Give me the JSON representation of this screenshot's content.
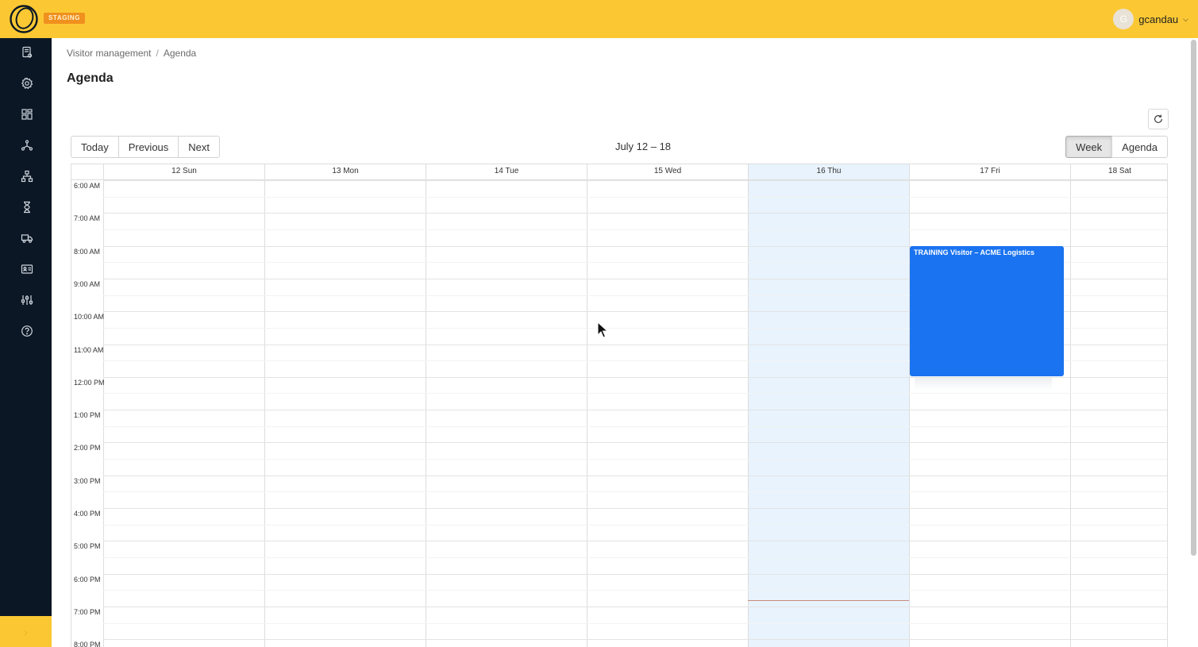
{
  "header": {
    "env_badge": "STAGING",
    "user": {
      "initial": "G",
      "name": "gcandau"
    }
  },
  "sidebar": {
    "items": [
      {
        "name": "report-icon"
      },
      {
        "name": "gear-icon"
      },
      {
        "name": "dashboard-icon"
      },
      {
        "name": "network-icon"
      },
      {
        "name": "org-chart-icon"
      },
      {
        "name": "hourglass-icon"
      },
      {
        "name": "truck-icon"
      },
      {
        "name": "id-card-icon"
      },
      {
        "name": "sliders-icon"
      },
      {
        "name": "help-icon"
      }
    ],
    "expand_label": "›"
  },
  "breadcrumb": {
    "parent": "Visitor management",
    "separator": "/",
    "current": "Agenda"
  },
  "page_title": "Agenda",
  "toolbar": {
    "today": "Today",
    "previous": "Previous",
    "next": "Next",
    "range": "July 12 – 18",
    "week": "Week",
    "agenda": "Agenda",
    "active_view": "week"
  },
  "calendar": {
    "days": [
      "12 Sun",
      "13 Mon",
      "14 Tue",
      "15 Wed",
      "16 Thu",
      "17 Fri",
      "18 Sat"
    ],
    "today_index": 4,
    "hours": [
      "6:00 AM",
      "7:00 AM",
      "8:00 AM",
      "9:00 AM",
      "10:00 AM",
      "11:00 AM",
      "12:00 PM",
      "1:00 PM",
      "2:00 PM",
      "3:00 PM",
      "4:00 PM",
      "5:00 PM",
      "6:00 PM",
      "7:00 PM",
      "8:00 PM"
    ],
    "events": [
      {
        "title": "TRAINING Visitor – ACME Logistics",
        "day_index": 5,
        "start_hour": 8.0,
        "end_hour": 12.0
      }
    ],
    "now_hour": 18.8
  },
  "colors": {
    "brand": "#fbc834",
    "sidebar": "#0b1724",
    "event": "#1a73f0",
    "today": "#e8f3fd"
  }
}
